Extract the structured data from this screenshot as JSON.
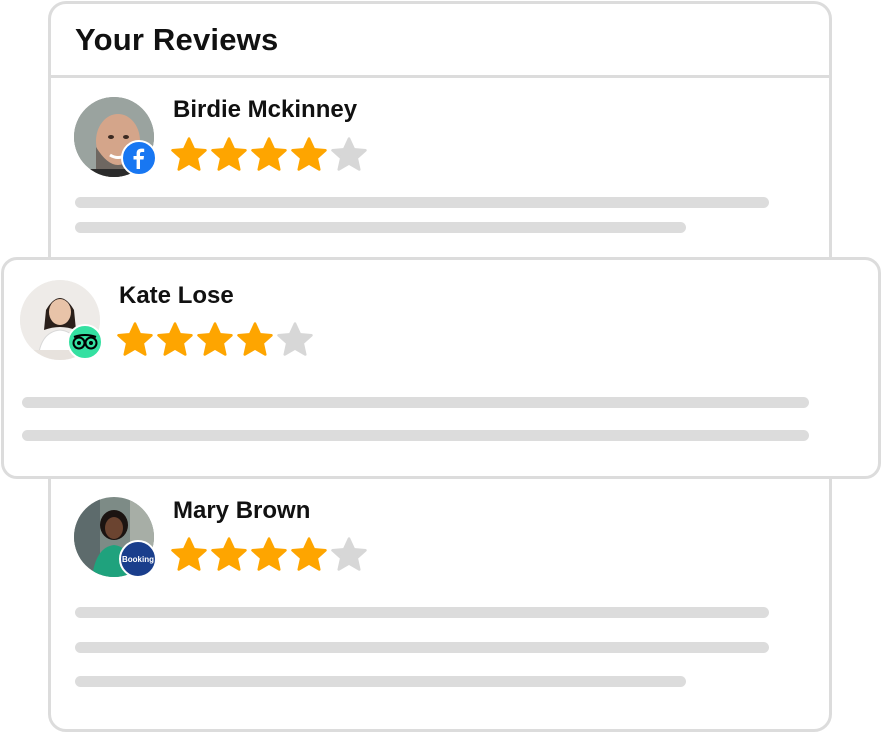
{
  "header": {
    "title": "Your Reviews"
  },
  "colors": {
    "star_filled": "#fea500",
    "star_empty": "#d7d7d7",
    "placeholder_line": "#dcdcdc",
    "border": "#dcdcdc"
  },
  "reviews": [
    {
      "name": "Birdie Mckinney",
      "rating": 4,
      "max_rating": 5,
      "source_icon": "facebook-icon"
    },
    {
      "name": "Kate Lose",
      "rating": 4,
      "max_rating": 5,
      "source_icon": "tripadvisor-icon"
    },
    {
      "name": "Mary Brown",
      "rating": 4,
      "max_rating": 5,
      "source": "Booking",
      "source_icon": "booking-icon"
    }
  ]
}
